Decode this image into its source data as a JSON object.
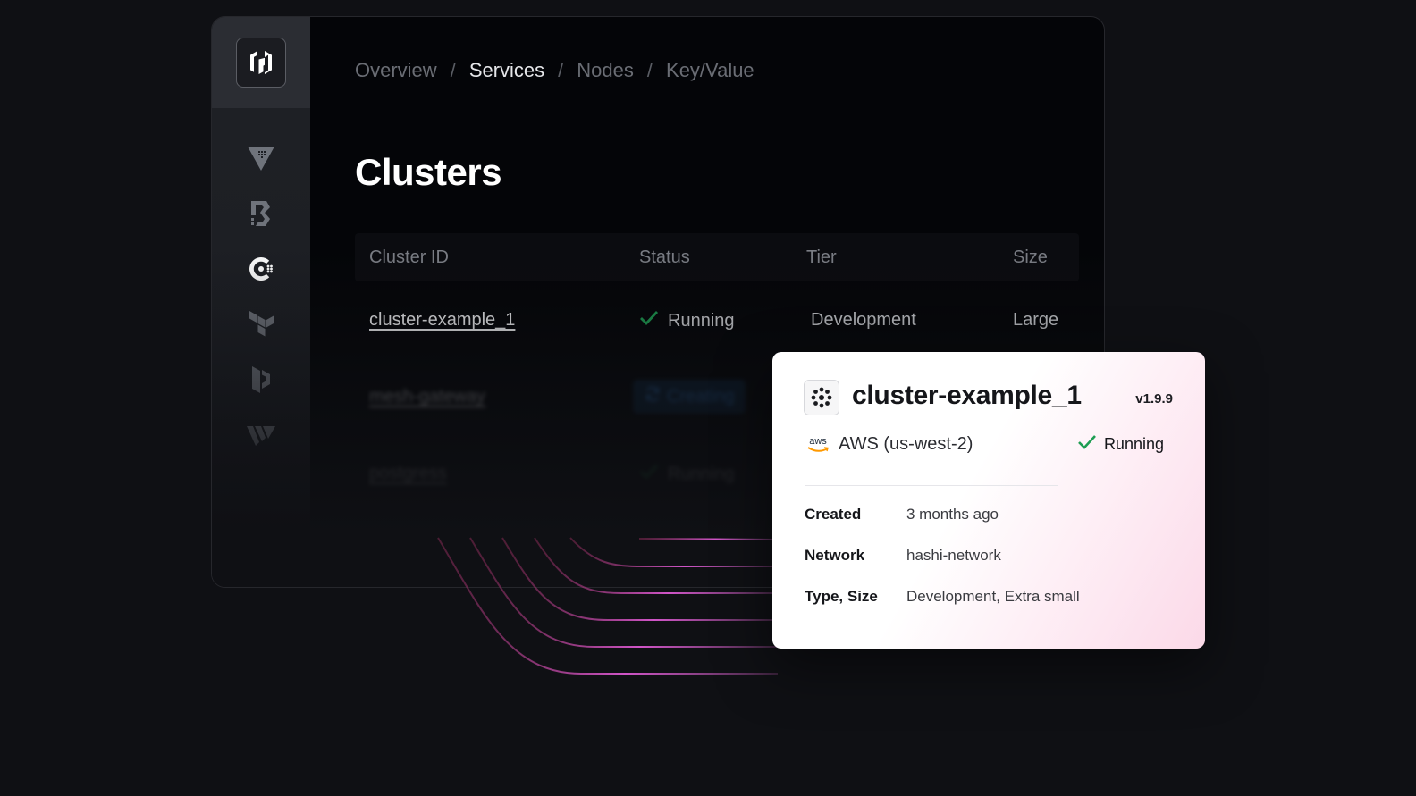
{
  "sidebar": {
    "logo_icon": "hashicorp-logo-icon",
    "items": [
      {
        "icon": "vault-icon"
      },
      {
        "icon": "boundary-icon"
      },
      {
        "icon": "consul-icon",
        "active": true
      },
      {
        "icon": "terraform-icon"
      },
      {
        "icon": "packer-icon"
      },
      {
        "icon": "waypoint-icon"
      }
    ]
  },
  "breadcrumb": {
    "items": [
      "Overview",
      "Services",
      "Nodes",
      "Key/Value"
    ],
    "separator": "/"
  },
  "page": {
    "title": "Clusters"
  },
  "table": {
    "columns": [
      "Cluster ID",
      "Status",
      "Tier",
      "Size"
    ],
    "rows": [
      {
        "cluster_id": "cluster-example_1",
        "status": "Running",
        "tier": "Development",
        "size": "Large"
      },
      {
        "cluster_id": "mesh-gateway",
        "status": "Creating"
      },
      {
        "cluster_id": "postgress",
        "status": "Running"
      }
    ]
  },
  "detail_card": {
    "icon": "consul-cluster-icon",
    "title": "cluster-example_1",
    "version": "v1.9.9",
    "provider_logo_text": "aws",
    "provider": "AWS (us-west-2)",
    "status": "Running",
    "details": [
      {
        "label": "Created",
        "value": "3 months ago"
      },
      {
        "label": "Network",
        "value": "hashi-network"
      },
      {
        "label": "Type, Size",
        "value": "Development, Extra small"
      }
    ]
  },
  "colors": {
    "background": "#0f1014",
    "running_green": "#1e9e53",
    "creating_blue": "#3a8ce6",
    "accent_pink": "#e05fd0"
  }
}
